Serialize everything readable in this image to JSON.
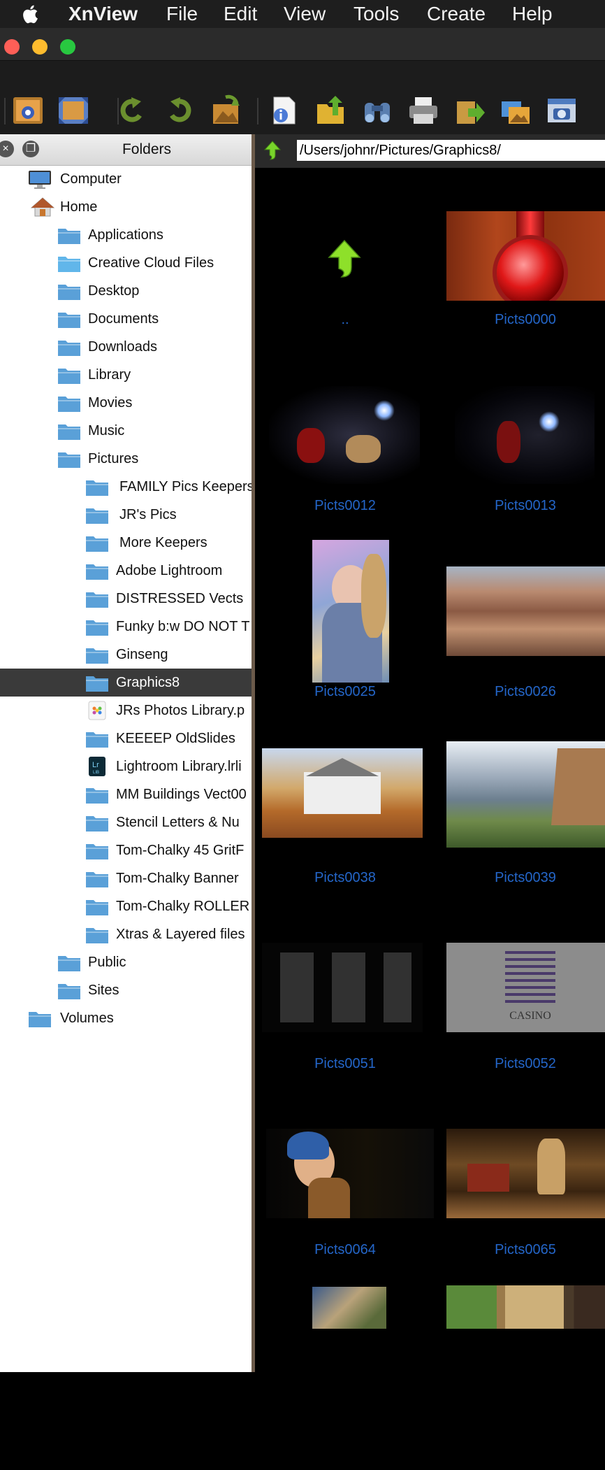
{
  "menubar": {
    "items": [
      "XnView",
      "File",
      "Edit",
      "View",
      "Tools",
      "Create",
      "Help"
    ]
  },
  "toolbar": {
    "buttons": [
      "view-icon",
      "fullscreen-icon",
      "rotate-left-icon",
      "rotate-right-icon",
      "convert-icon",
      "info-icon",
      "export-icon",
      "search-icon",
      "print-icon",
      "move-icon",
      "slideshow-icon",
      "capture-icon"
    ]
  },
  "folders_panel": {
    "title": "Folders",
    "items": [
      {
        "label": "Computer",
        "icon": "computer-icon"
      },
      {
        "label": "Home",
        "icon": "home-icon"
      },
      {
        "label": "Applications",
        "icon": "folder-icon"
      },
      {
        "label": "Creative Cloud Files",
        "icon": "folder-icon"
      },
      {
        "label": "Desktop",
        "icon": "folder-icon"
      },
      {
        "label": "Documents",
        "icon": "folder-icon"
      },
      {
        "label": "Downloads",
        "icon": "folder-icon"
      },
      {
        "label": "Library",
        "icon": "folder-icon"
      },
      {
        "label": "Movies",
        "icon": "folder-icon"
      },
      {
        "label": "Music",
        "icon": "folder-icon"
      },
      {
        "label": "Pictures",
        "icon": "folder-icon"
      },
      {
        "label": "FAMILY Pics Keepers",
        "icon": "folder-icon"
      },
      {
        "label": "JR's Pics",
        "icon": "folder-icon"
      },
      {
        "label": "More Keepers",
        "icon": "folder-icon"
      },
      {
        "label": "Adobe Lightroom",
        "icon": "folder-icon"
      },
      {
        "label": "DISTRESSED Vects",
        "icon": "folder-icon"
      },
      {
        "label": "Funky b:w DO NOT T",
        "icon": "folder-icon"
      },
      {
        "label": "Ginseng",
        "icon": "folder-icon"
      },
      {
        "label": "Graphics8",
        "icon": "folder-icon",
        "selected": true
      },
      {
        "label": "JRs Photos Library.p",
        "icon": "photos-library-icon"
      },
      {
        "label": "KEEEEP OldSlides",
        "icon": "folder-icon"
      },
      {
        "label": "Lightroom Library.lrli",
        "icon": "lightroom-icon"
      },
      {
        "label": "MM Buildings Vect00",
        "icon": "folder-icon"
      },
      {
        "label": "Stencil Letters & Nu",
        "icon": "folder-icon"
      },
      {
        "label": "Tom-Chalky 45 GritF",
        "icon": "folder-icon"
      },
      {
        "label": "Tom-Chalky Banner",
        "icon": "folder-icon"
      },
      {
        "label": "Tom-Chalky ROLLER",
        "icon": "folder-icon"
      },
      {
        "label": "Xtras & Layered files",
        "icon": "folder-icon"
      },
      {
        "label": "Public",
        "icon": "folder-icon"
      },
      {
        "label": "Sites",
        "icon": "folder-icon"
      },
      {
        "label": "Volumes",
        "icon": "folder-icon"
      }
    ]
  },
  "browser": {
    "path": "/Users/johnr/Pictures/Graphics8/",
    "thumbnails": [
      {
        "caption": "..",
        "kind": "parent-folder-icon"
      },
      {
        "caption": "Picts0000",
        "kind": "thermometer"
      },
      {
        "caption": "Picts0012",
        "kind": "spotlight-figures"
      },
      {
        "caption": "Picts0013",
        "kind": "spotlight-figure"
      },
      {
        "caption": "Picts0025",
        "kind": "portrait"
      },
      {
        "caption": "Picts0026",
        "kind": "canyon"
      },
      {
        "caption": "Picts0038",
        "kind": "house"
      },
      {
        "caption": "Picts0039",
        "kind": "landscape"
      },
      {
        "caption": "Picts0051",
        "kind": "pistols"
      },
      {
        "caption": "Picts0052",
        "kind": "casino"
      },
      {
        "caption": "Picts0064",
        "kind": "pearl-earring"
      },
      {
        "caption": "Picts0065",
        "kind": "dutch-interior"
      },
      {
        "caption": "",
        "kind": "painting"
      },
      {
        "caption": "",
        "kind": "triptych"
      }
    ],
    "casino_text": "CASINO"
  }
}
